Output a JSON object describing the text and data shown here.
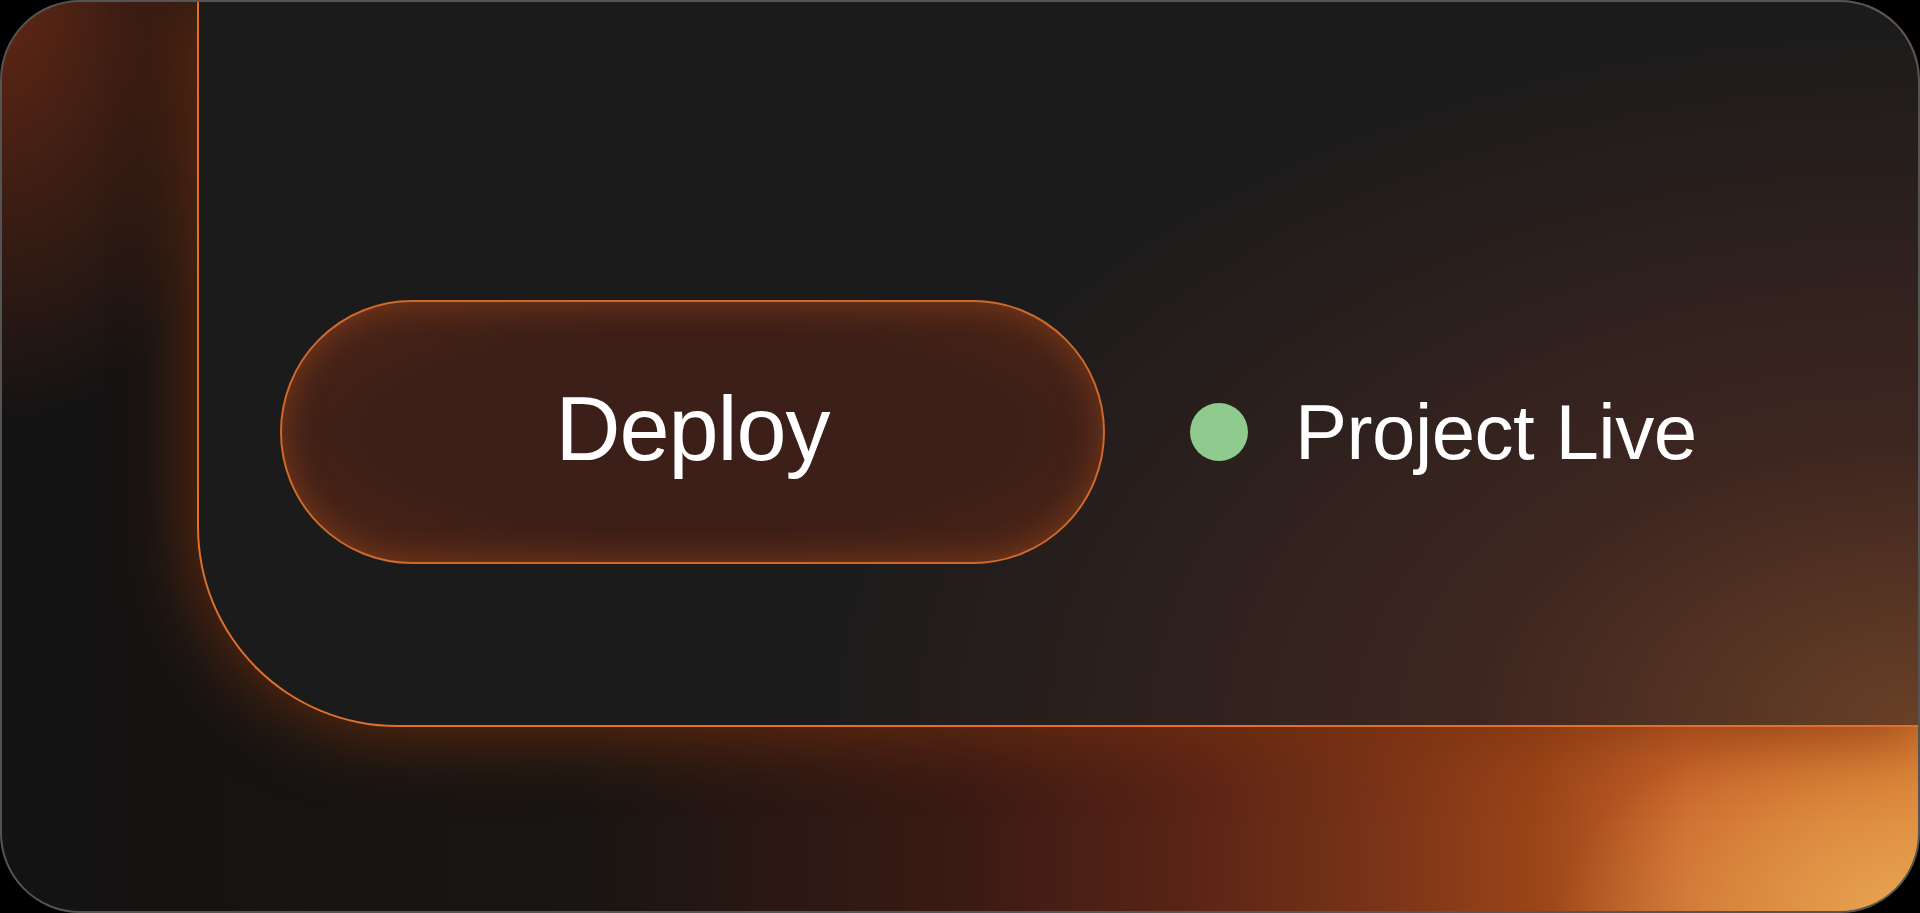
{
  "deploy_button": {
    "label": "Deploy"
  },
  "status": {
    "label": "Project Live",
    "color": "#8fcb8e"
  }
}
